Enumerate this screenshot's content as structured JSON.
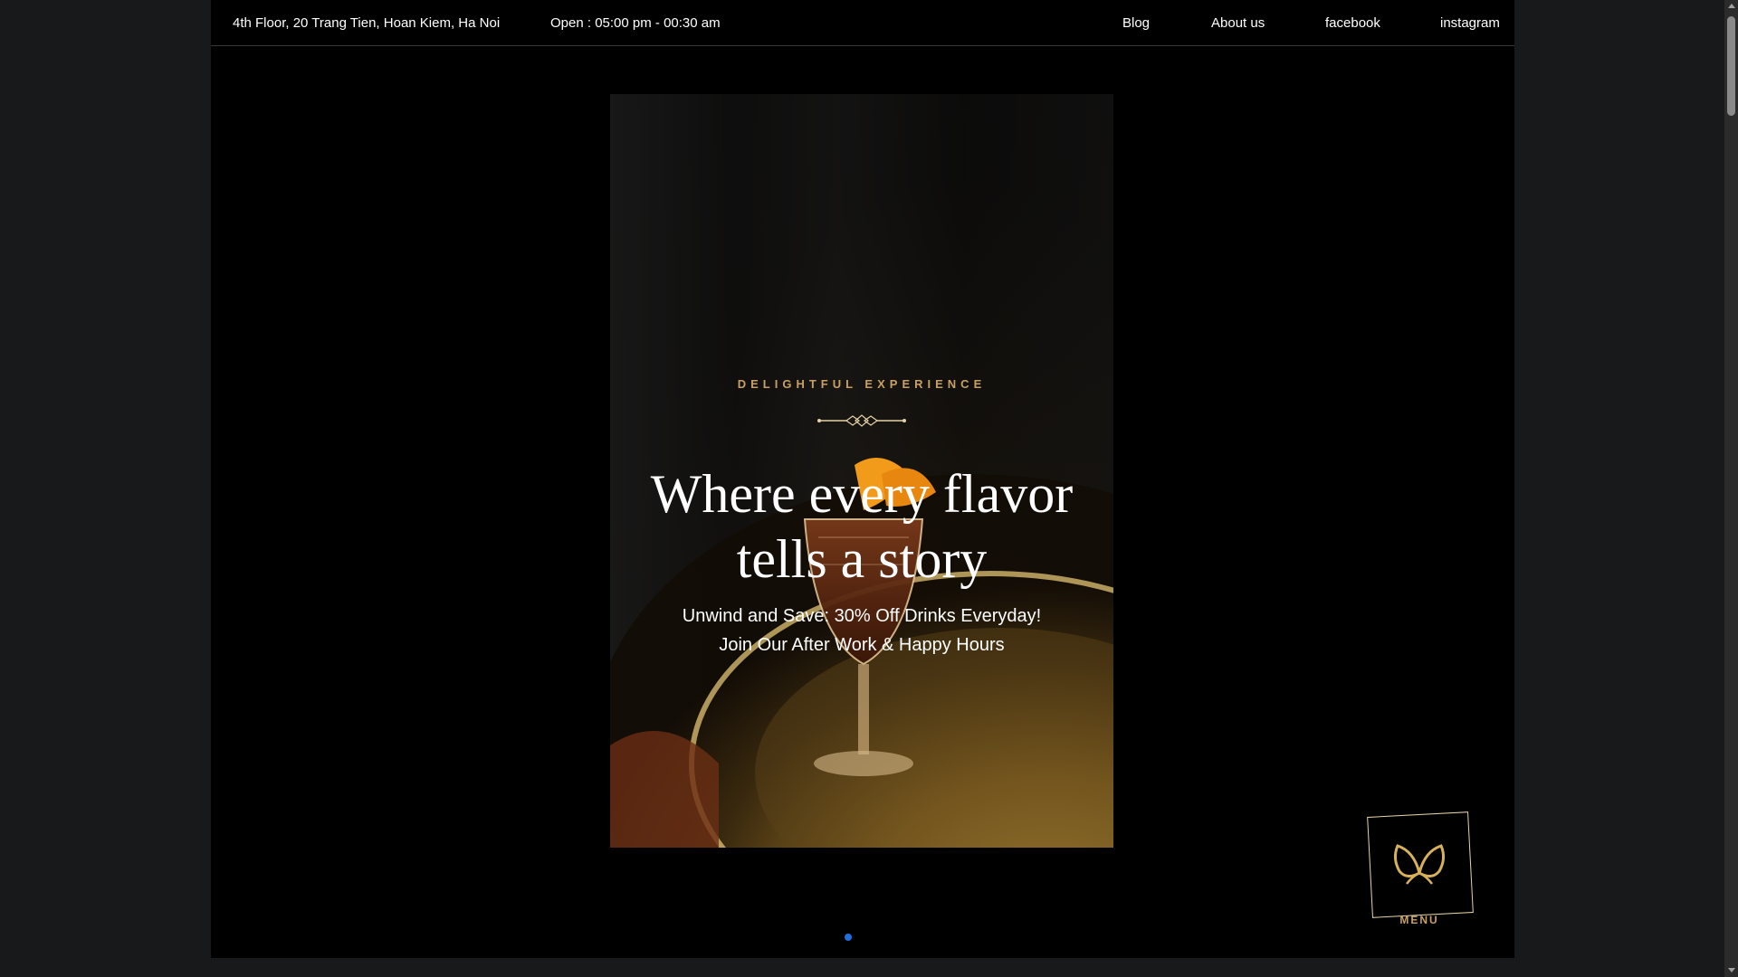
{
  "topbar": {
    "address": "4th Floor, 20 Trang Tien, Hoan Kiem, Ha Noi",
    "hours": "Open : 05:00 pm - 00:30 am",
    "nav": {
      "blog": "Blog",
      "about": "About us",
      "facebook": "facebook",
      "instagram": "instagram"
    }
  },
  "hero": {
    "eyebrow": "DELIGHTFUL EXPERIENCE",
    "headline": "Where every flavor tells a story",
    "subline_1": "Unwind and Save: 30% Off Drinks Everyday!",
    "subline_2": "Join Our After Work & Happy Hours",
    "image_icon": "cocktail-glass-on-golden-tray-image"
  },
  "slider": {
    "active_dot_color": "#1f6fe0"
  },
  "menu_button": {
    "label": "MENU",
    "icon": "butterfly-logo-icon"
  },
  "colors": {
    "accent_gold": "#c9a063",
    "background": "#000000",
    "page_background": "#17191a"
  }
}
